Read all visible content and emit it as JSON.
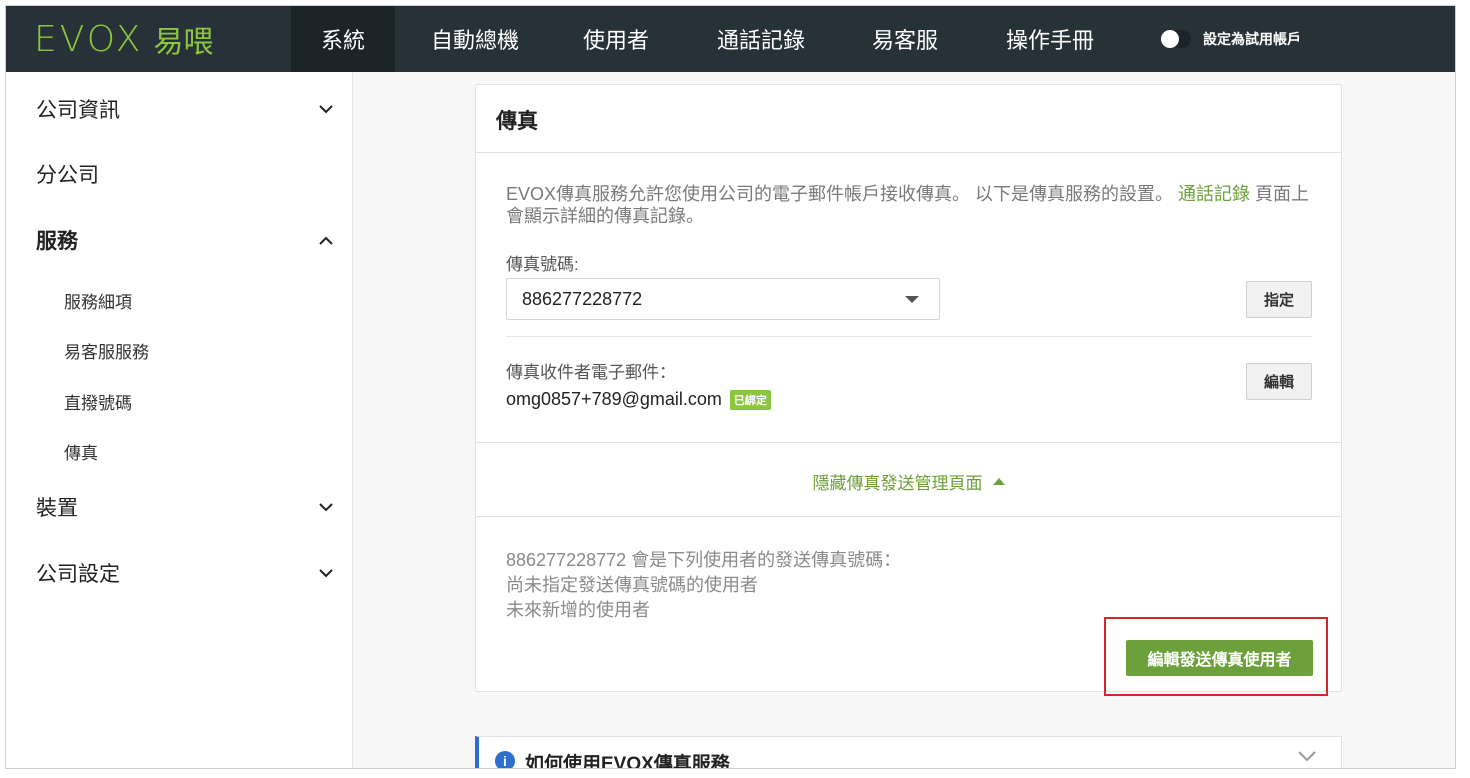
{
  "brand": {
    "word": "EVOX",
    "cn": "易喂"
  },
  "nav": {
    "items": [
      {
        "label": "系統",
        "active": true
      },
      {
        "label": "自動總機"
      },
      {
        "label": "使用者"
      },
      {
        "label": "通話記錄"
      },
      {
        "label": "易客服"
      },
      {
        "label": "操作手冊"
      }
    ],
    "trial_toggle_label": "設定為試用帳戶"
  },
  "sidebar": {
    "items": [
      {
        "label": "公司資訊",
        "icon": "chevron-down-icon"
      },
      {
        "label": "分公司"
      },
      {
        "label": "服務",
        "icon": "chevron-up-icon"
      },
      {
        "label": "裝置",
        "icon": "chevron-down-icon"
      },
      {
        "label": "公司設定",
        "icon": "chevron-down-icon"
      }
    ],
    "sub_items": [
      {
        "label": "服務細項"
      },
      {
        "label": "易客服服務"
      },
      {
        "label": "直撥號碼"
      },
      {
        "label": "傳真"
      }
    ]
  },
  "fax_card": {
    "title": "傳真",
    "description": "EVOX傳真服務允許您使用公司的電子郵件帳戶接收傳真。 以下是傳真服務的設置。",
    "description_link": "通話記錄",
    "description_tail": " 頁面上會顯示詳細的傳真記錄。",
    "fax_number_label": "傳真號碼:",
    "fax_number_value": "886277228772",
    "assign_button": "指定",
    "recipient_label": "傳真收件者電子郵件：",
    "recipient_email": "omg0857+789@gmail.com",
    "verified_badge": "已綁定",
    "edit_button": "編輯",
    "hide_toggle": "隱藏傳真發送管理頁面",
    "send_info_line1": "886277228772 會是下列使用者的發送傳真號碼：",
    "send_info_line2": "尚未指定發送傳真號碼的使用者",
    "send_info_line3": "未來新增的使用者",
    "edit_senders_button": "編輯發送傳真使用者"
  },
  "help_card": {
    "title": "如何使用EVOX傳真服務"
  },
  "colors": {
    "topbar": "#273238",
    "brand_green": "#8cc63f",
    "button_green": "#6ca03a",
    "highlight_red": "#d0282e",
    "info_blue": "#2d6fcf"
  }
}
